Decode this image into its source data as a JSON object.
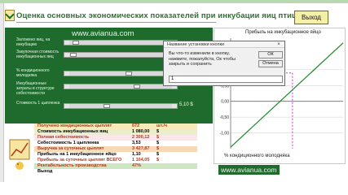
{
  "window": {
    "title": "Оценка основных экономических показателей при инкубации яиц птицы",
    "exit_button": "Выход"
  },
  "watermark": "www.avianua.com",
  "watermark_bottom": "www.avianua.com",
  "sliders": [
    {
      "label": "Заложено яиц, на инкубацию",
      "value": "",
      "position": 0.08
    },
    {
      "label": "Закупочная стоимость инкубационных яиц",
      "value": "",
      "position": 0.05
    },
    {
      "label": "% кондиционного молодняка",
      "value": "",
      "position": 0.55
    },
    {
      "label": "Инкубационные затраты в структуре себестоимости",
      "value": "",
      "position": 0.62
    },
    {
      "label": "Стоимость 1 цыпленка",
      "value": "5,10 $",
      "position": 0.35
    }
  ],
  "results": [
    {
      "label": "Получено кондиционных цыплят",
      "value": "672",
      "unit": "шт./ч",
      "bg": "#f7e9b8",
      "color": "#b0381b"
    },
    {
      "label": "Стоимость инкубационных яиц",
      "value": "1 080,00",
      "unit": "$",
      "bg": "#e9f0c9",
      "color": "#1b1b1b"
    },
    {
      "label": "Полная себестоимость",
      "value": "2 300,12",
      "unit": "$",
      "bg": "#fbe6ea",
      "color": "#b0381b"
    },
    {
      "label": "Себестоимость 1 цыпленка",
      "value": "3,53",
      "unit": "$",
      "bg": "#ffffff",
      "color": "#1b1b1b"
    },
    {
      "label": "Выручка за суточных цыплят",
      "value": "3 427,87",
      "unit": "$",
      "bg": "#f7d9b8",
      "color": "#b0381b"
    },
    {
      "label": "Прибыль на 1 инкубационное яйцо",
      "value": "1,10",
      "unit": "$",
      "bg": "#ffffff",
      "color": "#1b1b1b"
    },
    {
      "label": "Прибыль за суточных цыплят ВСЕГО",
      "value": "1 104,05",
      "unit": "$",
      "bg": "#ffffff",
      "color": "#b0381b"
    },
    {
      "label": "Рентабельность производства",
      "value": "47%",
      "unit": "",
      "bg": "#cfe6c2",
      "color": "#b0381b"
    },
    {
      "label": "Выход",
      "value": "",
      "unit": "",
      "bg": "#ffffff",
      "color": "#1b1b1b"
    }
  ],
  "chart_data": {
    "type": "line",
    "title": "Прибыль на инкубационное яйцо",
    "xlabel": "% кондиционного молодняка",
    "ylabel": "",
    "yticks": [
      "1,00",
      "0,50",
      "0,00",
      "-0,50",
      "-1,00"
    ],
    "series": [
      {
        "name": "",
        "x": [
          0,
          100
        ],
        "y": [
          -1.45,
          1.85
        ]
      }
    ],
    "grid": true,
    "highlight_color": "#cc33cc",
    "line_color": "#1c8a2a"
  },
  "dialog": {
    "title": "Название установки кнопки",
    "message": "Вы что-то изменили в кнопку, нажмите, пожалуйста, Ок чтобы закрыть и сохранить",
    "ok_label": "ОК",
    "cancel_label": "Отмена",
    "input_value": "1"
  }
}
